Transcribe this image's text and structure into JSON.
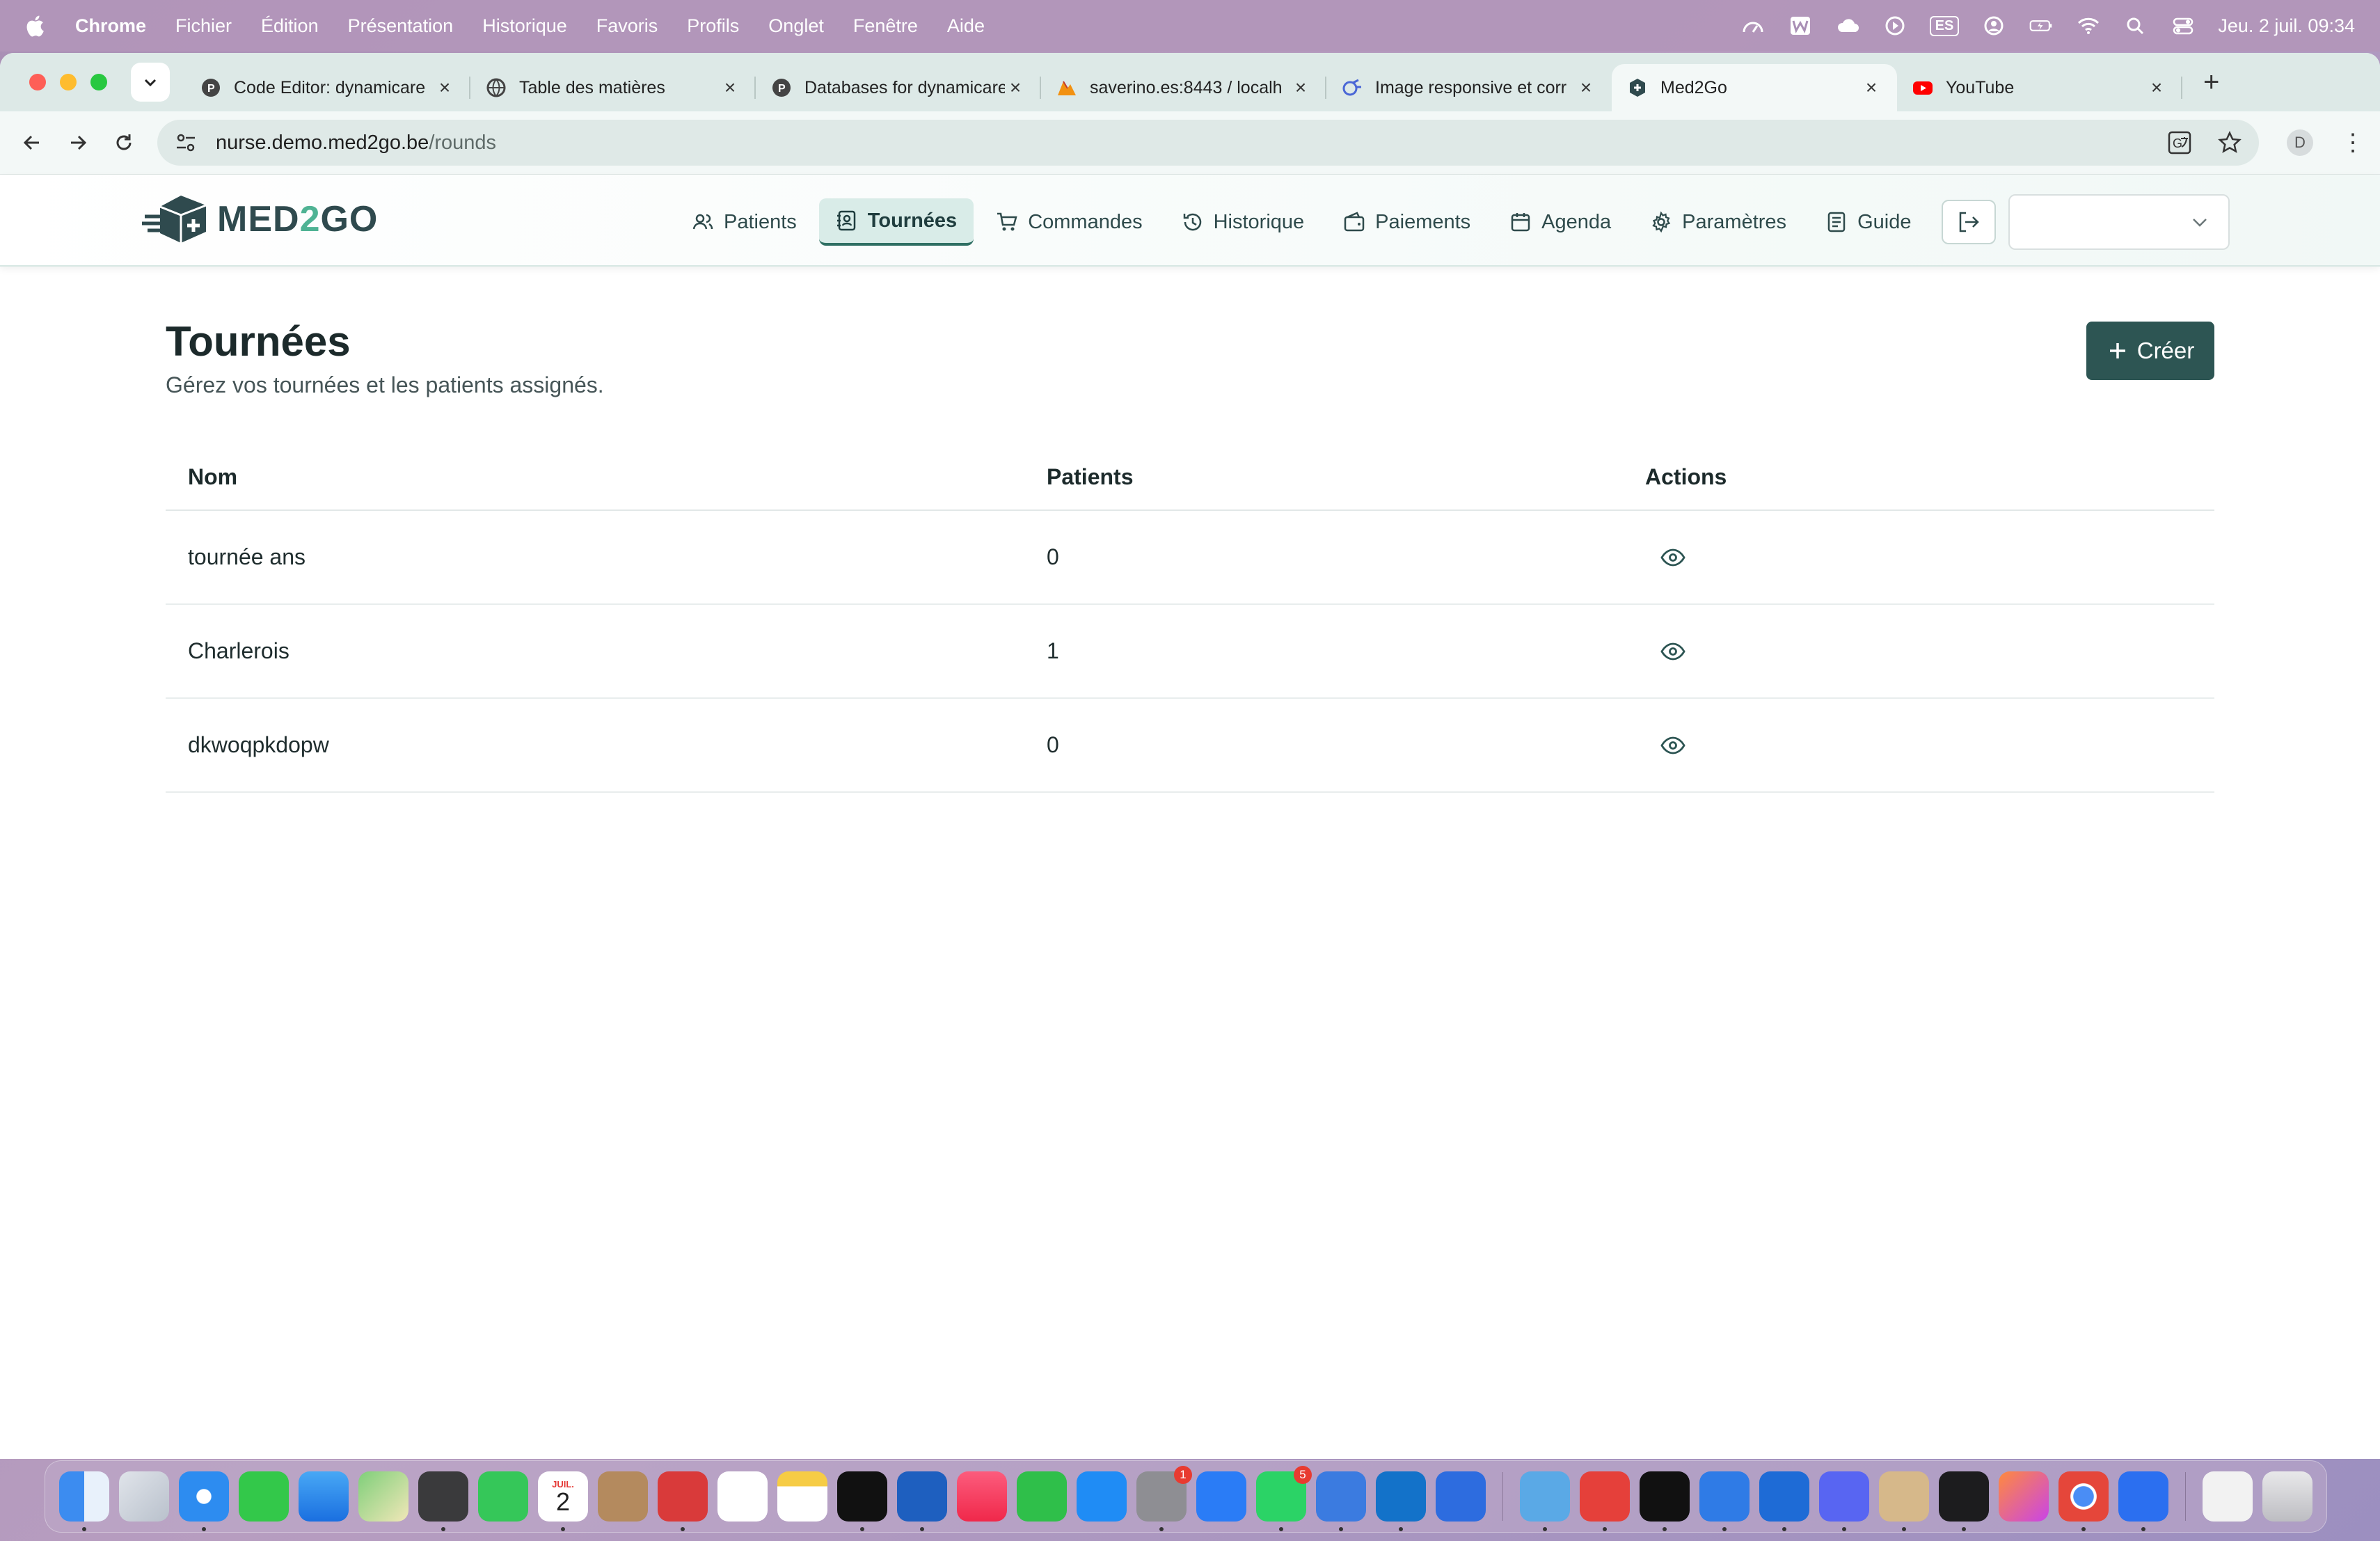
{
  "menubar": {
    "app": "Chrome",
    "items": [
      "Fichier",
      "Édition",
      "Présentation",
      "Historique",
      "Favoris",
      "Profils",
      "Onglet",
      "Fenêtre",
      "Aide"
    ],
    "keyboard_layout": "ES",
    "clock": "Jeu. 2 juil.  09:34"
  },
  "browser": {
    "tabs": [
      {
        "title": "Code Editor: dynamicare",
        "icon": "php-icon"
      },
      {
        "title": "Table des matières",
        "icon": "globe-icon"
      },
      {
        "title": "Databases for dynamicare",
        "icon": "php-icon"
      },
      {
        "title": "saverino.es:8443 / localh",
        "icon": "phpmyadmin-icon"
      },
      {
        "title": "Image responsive et corr",
        "icon": "ai-icon"
      },
      {
        "title": "Med2Go",
        "icon": "med2go-icon",
        "active": true
      },
      {
        "title": "YouTube",
        "icon": "youtube-icon"
      }
    ],
    "url_host": "nurse.demo.med2go.be",
    "url_path": "/rounds",
    "profile_initial": "D"
  },
  "app": {
    "logo_text_a": "MED",
    "logo_text_b": "2",
    "logo_text_c": "GO",
    "nav": [
      {
        "label": "Patients",
        "icon": "users-icon"
      },
      {
        "label": "Tournées",
        "icon": "contact-book-icon",
        "active": true
      },
      {
        "label": "Commandes",
        "icon": "cart-icon"
      },
      {
        "label": "Historique",
        "icon": "history-icon"
      },
      {
        "label": "Paiements",
        "icon": "wallet-icon"
      },
      {
        "label": "Agenda",
        "icon": "calendar-icon"
      },
      {
        "label": "Paramètres",
        "icon": "gear-icon"
      },
      {
        "label": "Guide",
        "icon": "document-icon"
      }
    ],
    "select_value": ""
  },
  "page": {
    "title": "Tournées",
    "subtitle": "Gérez vos tournées et les patients assignés.",
    "create_label": "Créer",
    "table": {
      "headers": {
        "name": "Nom",
        "patients": "Patients",
        "actions": "Actions"
      },
      "rows": [
        {
          "name": "tournée ans",
          "patients": "0"
        },
        {
          "name": "Charlerois",
          "patients": "1"
        },
        {
          "name": "dkwoqpkdopw",
          "patients": "0"
        }
      ]
    }
  },
  "dock": {
    "calendar_month": "JUIL.",
    "calendar_day": "2",
    "badges": {
      "system-settings": "1",
      "whatsapp": "5"
    }
  },
  "colors": {
    "accent": "#2d5553",
    "nav_active_bg": "#d9ece8",
    "tabbar_bg": "#dde9e7"
  }
}
